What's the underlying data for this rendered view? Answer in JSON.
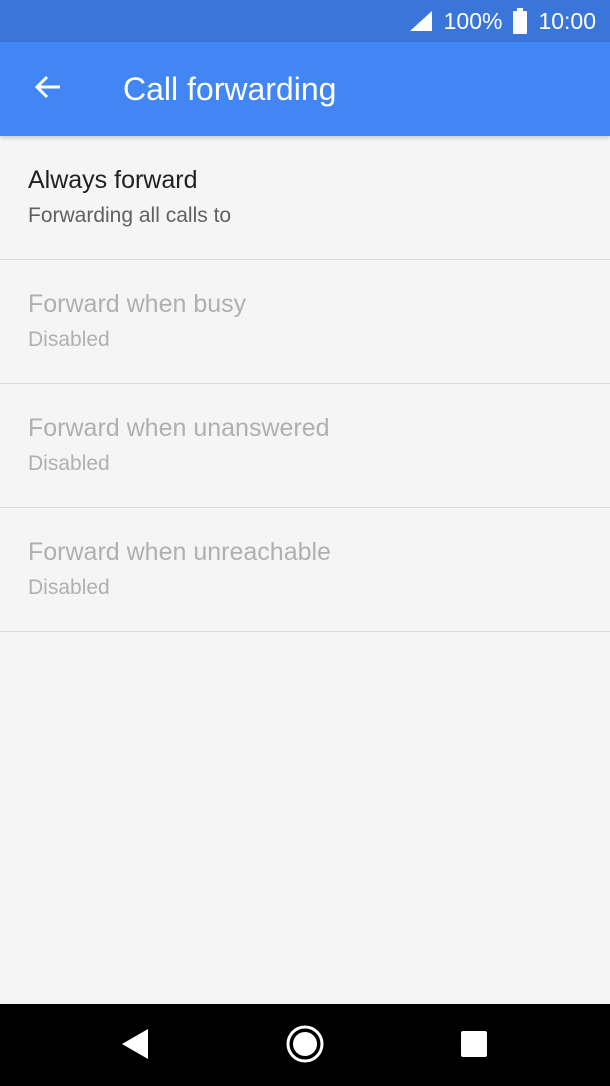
{
  "status_bar": {
    "battery_percent": "100%",
    "time": "10:00",
    "icons": [
      "signal-icon",
      "battery-icon"
    ]
  },
  "toolbar": {
    "title": "Call forwarding",
    "back_icon": "arrow-back-icon",
    "background_color": "#4286f4"
  },
  "forward_options": [
    {
      "title": "Always forward",
      "subtitle": "Forwarding all calls to",
      "enabled": true
    },
    {
      "title": "Forward when busy",
      "subtitle": "Disabled",
      "enabled": false
    },
    {
      "title": "Forward when unanswered",
      "subtitle": "Disabled",
      "enabled": false
    },
    {
      "title": "Forward when unreachable",
      "subtitle": "Disabled",
      "enabled": false
    }
  ],
  "nav_bar": {
    "buttons": [
      "back-triangle-icon",
      "home-circle-icon",
      "recents-square-icon"
    ]
  }
}
